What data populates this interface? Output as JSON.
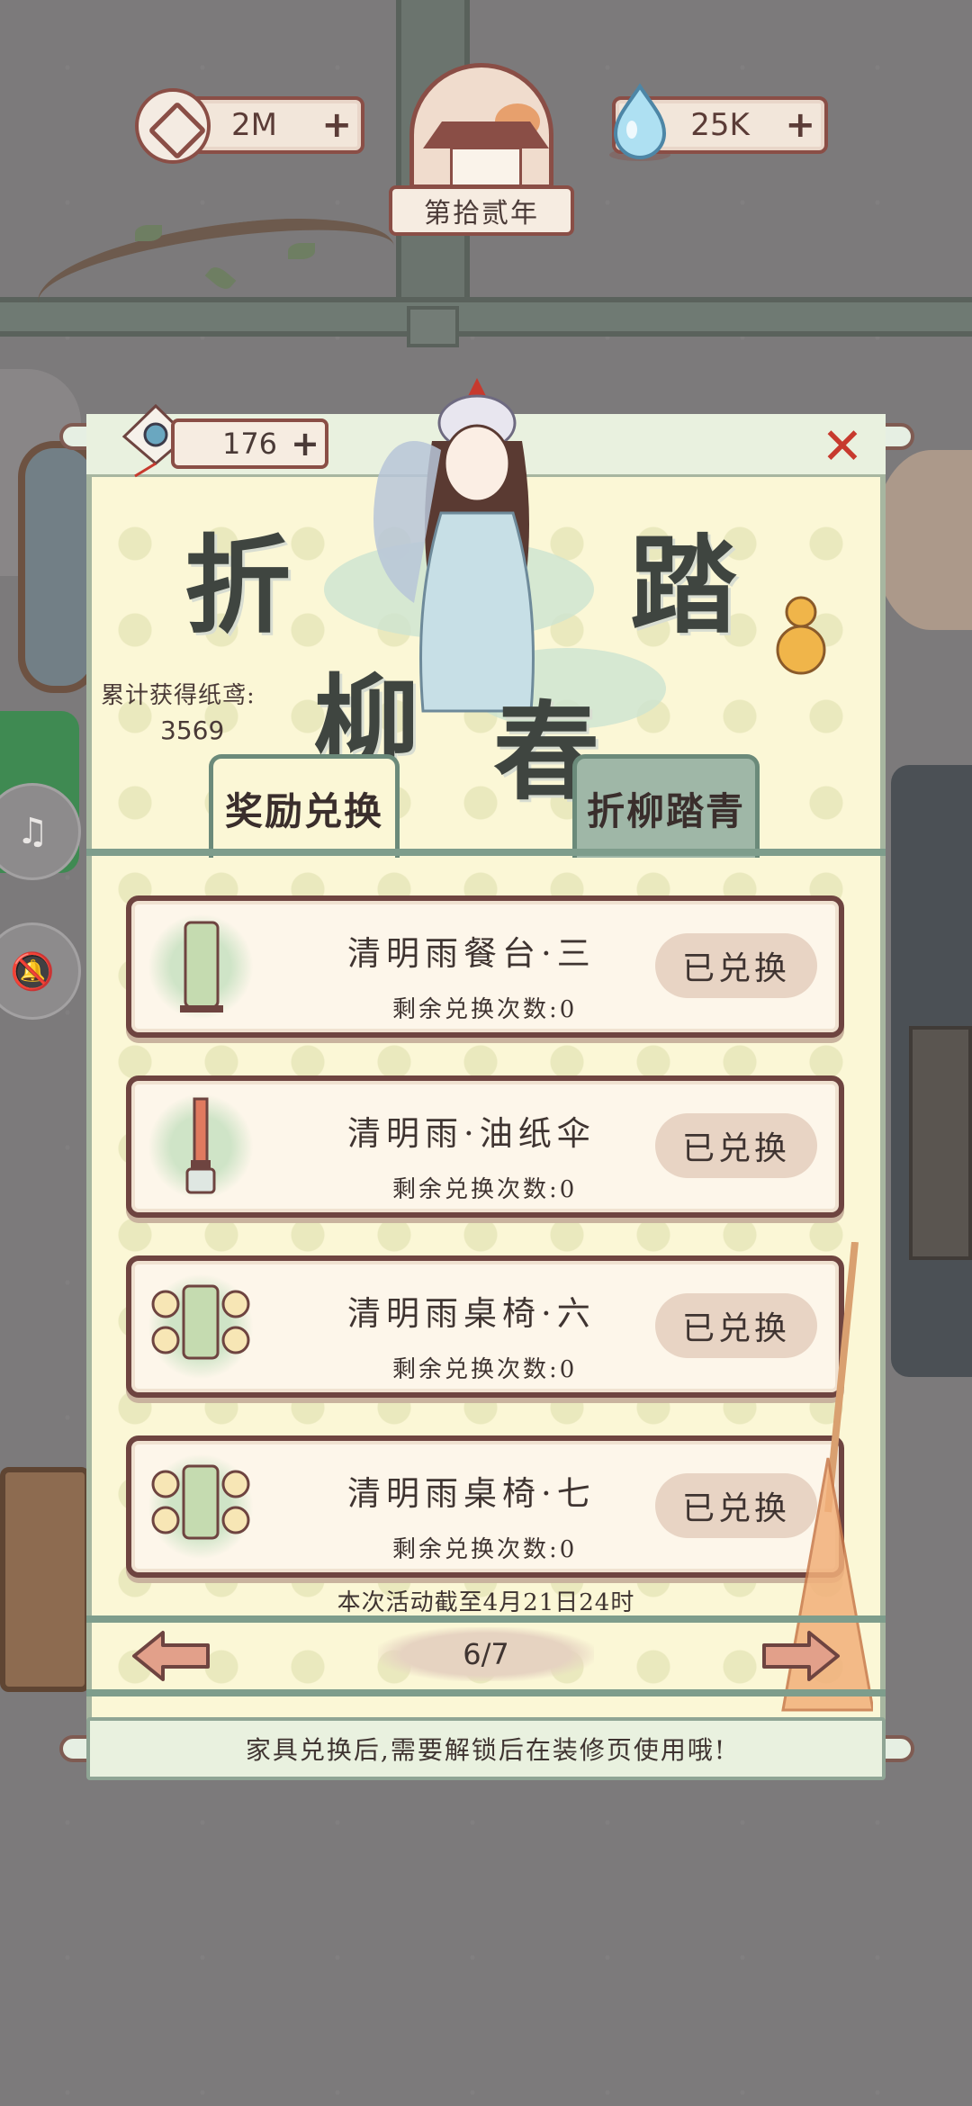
{
  "top_bar": {
    "coins": "2M",
    "water": "25K",
    "year": "第拾贰年"
  },
  "event": {
    "kites": "176",
    "title_chars": [
      "折",
      "柳",
      "踏",
      "春"
    ],
    "collected_label": "累计获得纸鸢:",
    "collected_value": "3569"
  },
  "tabs": [
    {
      "label": "奖励兑换",
      "active": true
    },
    {
      "label": "折柳踏青",
      "active": false
    }
  ],
  "items": [
    {
      "name": "清明雨餐台·三",
      "remaining": "剩余兑换次数:0",
      "button": "已兑换"
    },
    {
      "name": "清明雨·油纸伞",
      "remaining": "剩余兑换次数:0",
      "button": "已兑换"
    },
    {
      "name": "清明雨桌椅·六",
      "remaining": "剩余兑换次数:0",
      "button": "已兑换"
    },
    {
      "name": "清明雨桌椅·七",
      "remaining": "剩余兑换次数:0",
      "button": "已兑换"
    }
  ],
  "deadline": "本次活动截至4月21日24时",
  "pager": {
    "label": "6/7"
  },
  "notice": "家具兑换后,需要解锁后在装修页使用哦!",
  "colors": {
    "frame": "#8a4e46",
    "close": "#c73a2e",
    "panel": "#fbf7d6",
    "tab_inactive": "#9fb7a7"
  },
  "icons": [
    "coin-icon",
    "water-drop-icon",
    "kite-icon",
    "close-icon",
    "prev-arrow-icon",
    "next-arrow-icon",
    "music-icon",
    "mute-bell-icon"
  ]
}
